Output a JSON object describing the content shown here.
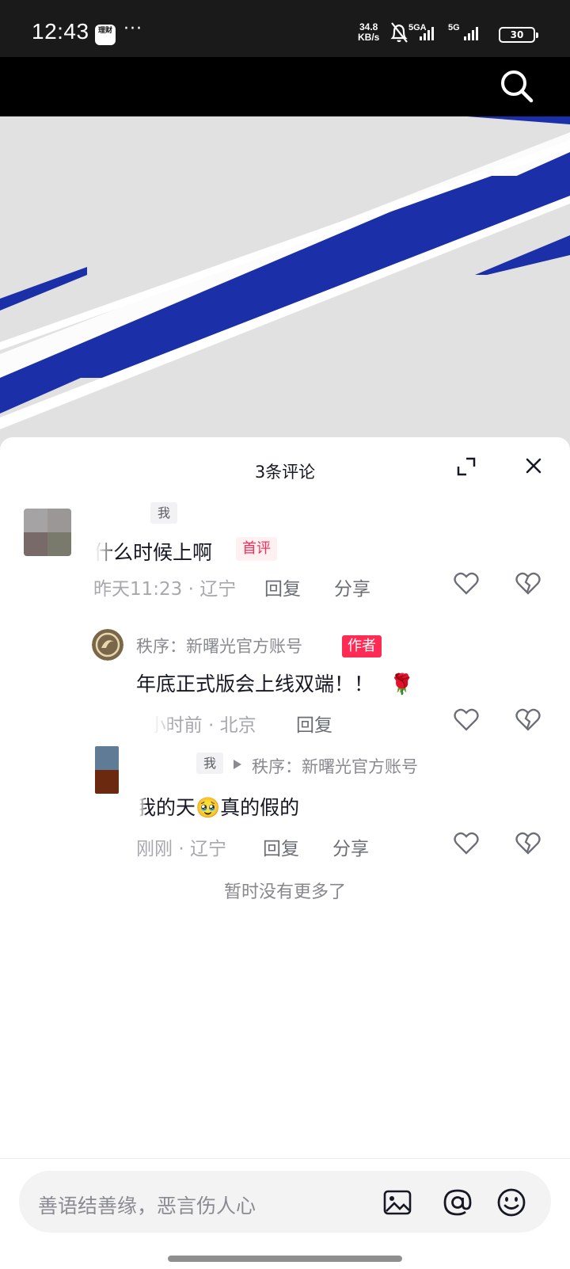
{
  "status_bar": {
    "time": "12:43",
    "app_icon_text": "理财",
    "more_dots": "···",
    "net_speed_value": "34.8",
    "net_speed_unit": "KB/s",
    "signal_1_label": "5GA",
    "signal_2_label": "5G",
    "battery_level": "30"
  },
  "top_bar": {
    "search_icon": "search-icon"
  },
  "comments_panel": {
    "title": "3条评论",
    "expand_icon": "expand-icon",
    "close_icon": "close-icon",
    "comments": [
      {
        "author_tag": "我",
        "text": "什么时候上啊",
        "badge": "首评",
        "time": "昨天11:23",
        "location": "辽宁",
        "reply_label": "回复",
        "share_label": "分享"
      }
    ],
    "replies": [
      {
        "author_name": "秩序：新曙光官方账号",
        "badge": "作者",
        "text": "年底正式版会上线双端！！",
        "emoji": "🌹",
        "time": "1小时前",
        "location": "北京",
        "reply_label": "回复"
      },
      {
        "author_tag": "我",
        "reply_to": "秩序：新曙光官方账号",
        "text_before_emoji": "我的天",
        "emoji": "🥹",
        "text_after_emoji": "真的假的",
        "time": "刚刚",
        "location": "辽宁",
        "reply_label": "回复",
        "share_label": "分享"
      }
    ],
    "no_more": "暂时没有更多了"
  },
  "input_bar": {
    "placeholder": "善语结善缘，恶言伤人心",
    "icons": [
      "image-icon",
      "at-icon",
      "emoji-icon"
    ]
  },
  "colors": {
    "accent": "#fe2c55",
    "video_stripe_blue": "#1a2fa8",
    "video_background": "#e1e1e1"
  }
}
